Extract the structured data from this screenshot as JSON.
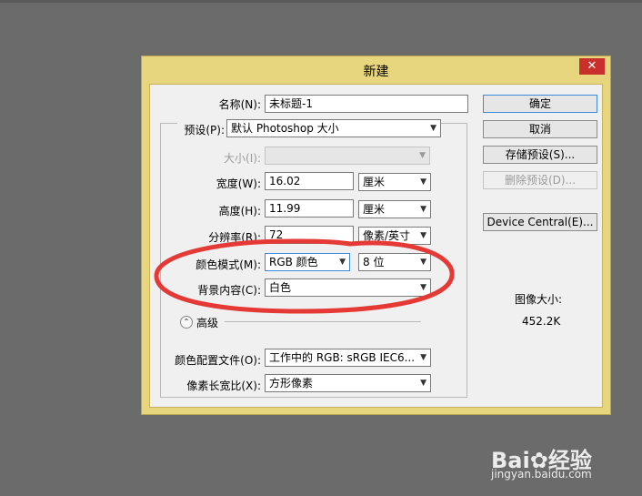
{
  "dialog": {
    "title": "新建",
    "close_icon": "close-icon",
    "fields": {
      "name_label": "名称(N):",
      "name_value": "未标题-1",
      "preset_label": "预设(P):",
      "preset_value": "默认 Photoshop 大小",
      "size_label": "大小(I):",
      "size_value": "",
      "width_label": "宽度(W):",
      "width_value": "16.02",
      "width_unit": "厘米",
      "height_label": "高度(H):",
      "height_value": "11.99",
      "height_unit": "厘米",
      "resolution_label": "分辨率(R):",
      "resolution_value": "72",
      "resolution_unit": "像素/英寸",
      "color_mode_label": "颜色模式(M):",
      "color_mode_value": "RGB 颜色",
      "bit_depth_value": "8 位",
      "background_label": "背景内容(C):",
      "background_value": "白色",
      "advanced_label": "高级",
      "color_profile_label": "颜色配置文件(O):",
      "color_profile_value": "工作中的 RGB: sRGB IEC6...",
      "pixel_aspect_label": "像素长宽比(X):",
      "pixel_aspect_value": "方形像素"
    },
    "buttons": {
      "ok": "确定",
      "cancel": "取消",
      "save_preset": "存储预设(S)...",
      "delete_preset": "删除预设(D)...",
      "device_central": "Device Central(E)..."
    },
    "image_size": {
      "label": "图像大小:",
      "value": "452.2K"
    }
  },
  "annotation": {
    "color": "#e53935"
  },
  "watermark": {
    "logo_text": "Bai",
    "logo_text2": "经验",
    "url": "jingyan.baidu.com"
  }
}
